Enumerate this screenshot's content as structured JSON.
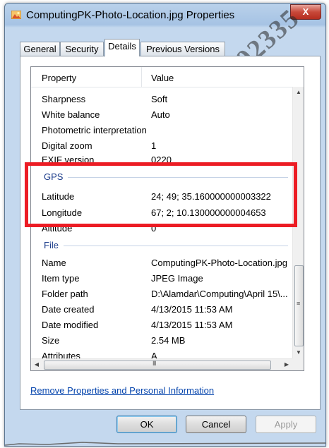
{
  "window": {
    "title": "ComputingPK-Photo-Location.jpg Properties",
    "close_label": "X",
    "watermark": "92335"
  },
  "tabs": [
    {
      "label": "General",
      "active": false
    },
    {
      "label": "Security",
      "active": false
    },
    {
      "label": "Details",
      "active": true
    },
    {
      "label": "Previous Versions",
      "active": false
    }
  ],
  "details": {
    "columns": {
      "property": "Property",
      "value": "Value"
    },
    "camera_rows": [
      {
        "property": "Sharpness",
        "value": "Soft"
      },
      {
        "property": "White balance",
        "value": "Auto"
      },
      {
        "property": "Photometric interpretation",
        "value": ""
      },
      {
        "property": "Digital zoom",
        "value": "1"
      },
      {
        "property": "EXIF version",
        "value": "0220"
      }
    ],
    "gps_group": {
      "label": "GPS",
      "rows": [
        {
          "property": "Latitude",
          "value": "24; 49; 35.160000000003322"
        },
        {
          "property": "Longitude",
          "value": "67; 2; 10.130000000004653"
        },
        {
          "property": "Altitude",
          "value": "0"
        }
      ]
    },
    "file_group": {
      "label": "File",
      "rows": [
        {
          "property": "Name",
          "value": "ComputingPK-Photo-Location.jpg"
        },
        {
          "property": "Item type",
          "value": "JPEG Image"
        },
        {
          "property": "Folder path",
          "value": "D:\\Alamdar\\Computing\\April 15\\..."
        },
        {
          "property": "Date created",
          "value": "4/13/2015 11:53 AM"
        },
        {
          "property": "Date modified",
          "value": "4/13/2015 11:53 AM"
        },
        {
          "property": "Size",
          "value": "2.54 MB"
        },
        {
          "property": "Attributes",
          "value": "A"
        }
      ]
    }
  },
  "link": {
    "label": "Remove Properties and Personal Information"
  },
  "buttons": {
    "ok": "OK",
    "cancel": "Cancel",
    "apply": "Apply"
  },
  "colors": {
    "highlight": "#ec1c24",
    "group_label": "#1e3e8c",
    "link": "#0645ad"
  }
}
